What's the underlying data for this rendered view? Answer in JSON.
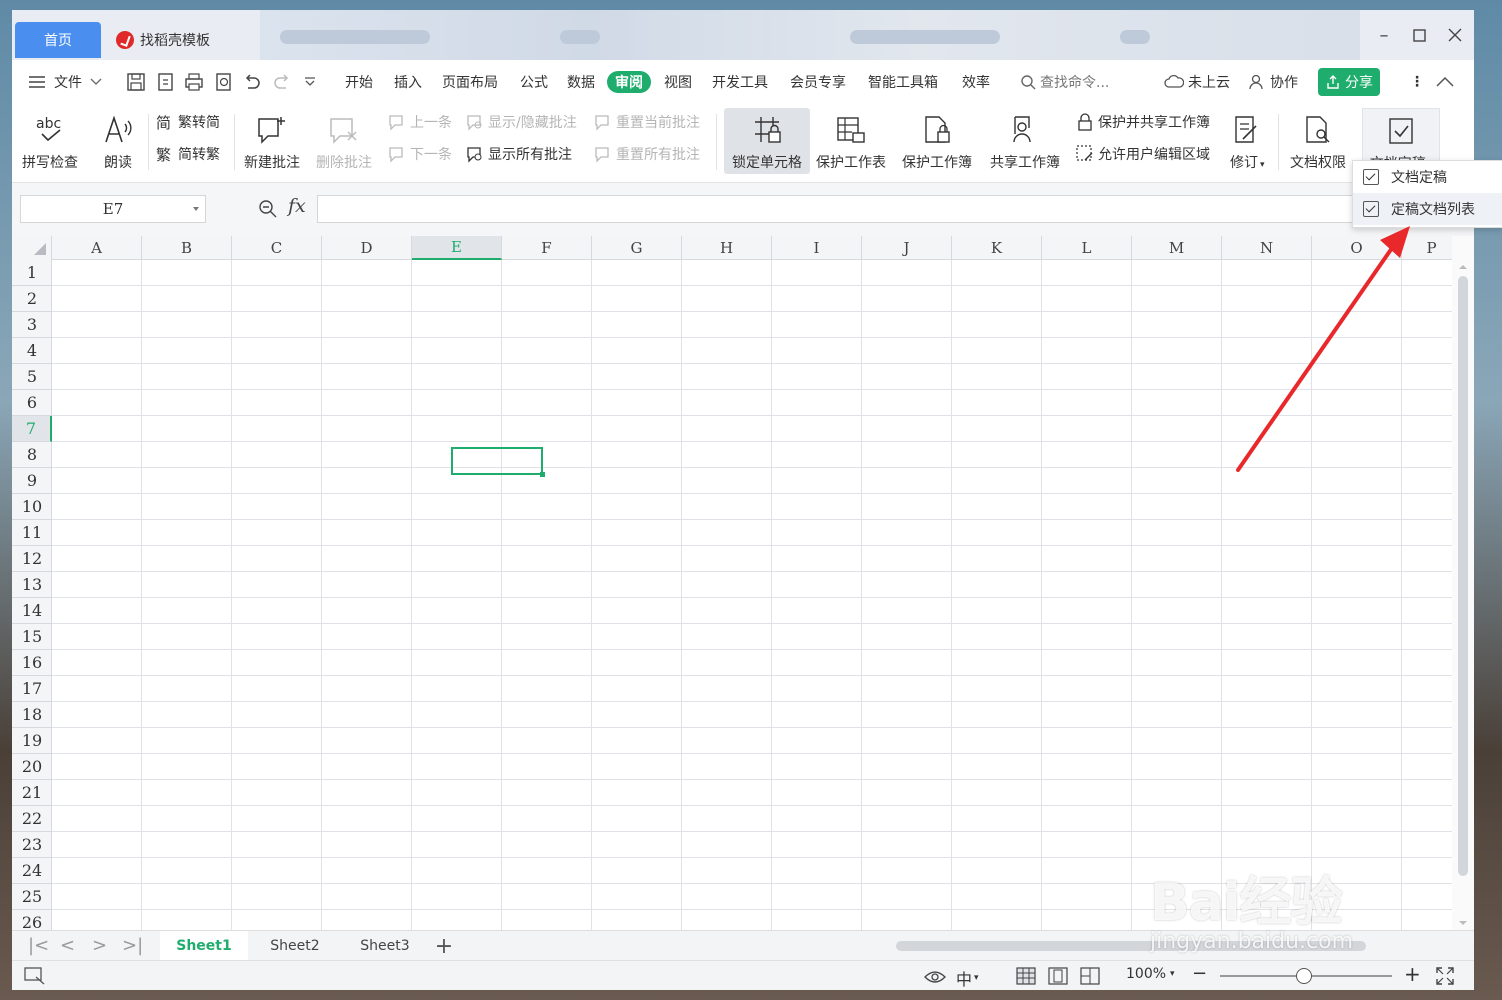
{
  "titlebar": {
    "home_tab": "首页",
    "template_tab": "找稻壳模板"
  },
  "menu": {
    "file": "文件",
    "items": [
      "开始",
      "插入",
      "页面布局",
      "公式",
      "数据",
      "审阅",
      "视图",
      "开发工具",
      "会员专享",
      "智能工具箱",
      "效率"
    ],
    "active": "审阅",
    "search_placeholder": "查找命令...",
    "cloud": "未上云",
    "collab": "协作",
    "share": "分享"
  },
  "ribbon": {
    "spellcheck": "拼写检查",
    "read_aloud": "朗读",
    "trad_to_simp": "繁转简",
    "simp_to_trad": "简转繁",
    "new_comment": "新建批注",
    "delete_comment": "删除批注",
    "prev": "上一条",
    "next": "下一条",
    "show_hide_comment": "显示/隐藏批注",
    "show_all_comments": "显示所有批注",
    "reset_current_comment": "重置当前批注",
    "reset_all_comments": "重置所有批注",
    "lock_cell": "锁定单元格",
    "protect_sheet": "保护工作表",
    "protect_workbook": "保护工作簿",
    "share_workbook": "共享工作簿",
    "protect_share_workbook": "保护并共享工作簿",
    "allow_edit_ranges": "允许用户编辑区域",
    "revise": "修订",
    "doc_permission": "文档权限",
    "doc_finalize": "文档定稿"
  },
  "dropdown": {
    "items": [
      "文档定稿",
      "定稿文档列表"
    ]
  },
  "formula": {
    "name_box": "E7",
    "fx": "fx",
    "value": ""
  },
  "grid": {
    "columns": [
      "A",
      "B",
      "C",
      "D",
      "E",
      "F",
      "G",
      "H",
      "I",
      "J",
      "K",
      "L",
      "M",
      "N",
      "O",
      "P"
    ],
    "rows": [
      "1",
      "2",
      "3",
      "4",
      "5",
      "6",
      "7",
      "8",
      "9",
      "10",
      "11",
      "12",
      "13",
      "14",
      "15",
      "16",
      "17",
      "18",
      "19",
      "20",
      "21",
      "22",
      "23",
      "24",
      "25",
      "26"
    ],
    "selected_column": "E",
    "selected_row": "7"
  },
  "sheets": {
    "tabs": [
      "Sheet1",
      "Sheet2",
      "Sheet3"
    ],
    "active": "Sheet1",
    "add": "+"
  },
  "status": {
    "zoom": "100%"
  },
  "watermark": {
    "brand": "Bai经验",
    "url": "jingyan.baidu.com"
  },
  "colors": {
    "accent_green": "#1fad6e",
    "home_tab_blue": "#4a8ef0",
    "arrow_red": "#e8282b"
  }
}
